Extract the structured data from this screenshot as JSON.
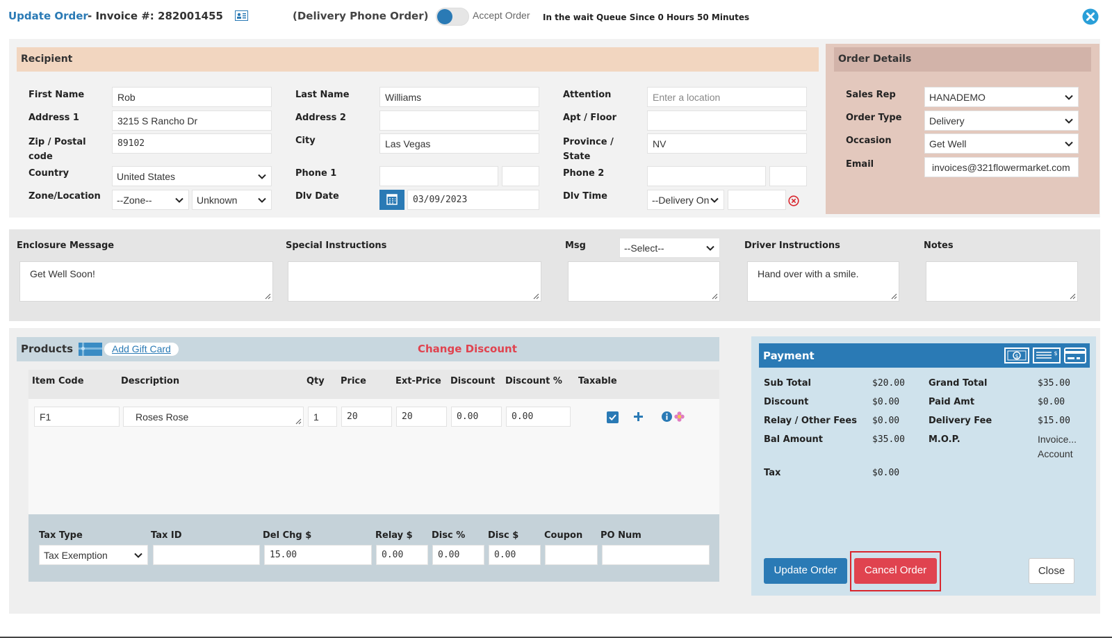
{
  "header": {
    "title": "Update Order",
    "invoice_label": "- Invoice #: 282001455",
    "order_kind": "(Delivery Phone Order)",
    "accept_label": "Accept Order",
    "queue_text": "In the wait Queue Since 0 Hours 50 Minutes"
  },
  "recipient": {
    "heading": "Recipient",
    "first_name_label": "First Name",
    "first_name": "Rob",
    "last_name_label": "Last Name",
    "last_name": "Williams",
    "attention_label": "Attention",
    "attention_placeholder": "Enter a location",
    "address1_label": "Address 1",
    "address1": "3215 S Rancho Dr",
    "address2_label": "Address 2",
    "address2": "",
    "apt_label": "Apt / Floor",
    "apt": "",
    "zip_label": "Zip / Postal code",
    "zip": "89102",
    "city_label": "City",
    "city": "Las Vegas",
    "province_label": "Province / State",
    "province": "NV",
    "country_label": "Country",
    "country": "United States",
    "phone1_label": "Phone 1",
    "phone2_label": "Phone 2",
    "zone_label": "Zone/Location",
    "zone": "--Zone--",
    "location": "Unknown",
    "dlv_date_label": "Dlv Date",
    "dlv_date": "03/09/2023",
    "dlv_time_label": "Dlv Time",
    "dlv_time": "--Delivery On"
  },
  "order_details": {
    "heading": "Order Details",
    "sales_rep_label": "Sales Rep",
    "sales_rep": "HANADEMO",
    "order_type_label": "Order Type",
    "order_type": "Delivery",
    "occasion_label": "Occasion",
    "occasion": "Get Well",
    "email_label": "Email",
    "email": "invoices@321flowermarket.com"
  },
  "messages": {
    "enclosure_label": "Enclosure Message",
    "enclosure": "Get Well Soon!",
    "special_label": "Special Instructions",
    "special": "",
    "msg_label": "Msg",
    "msg_select": "--Select--",
    "msg": "",
    "driver_label": "Driver Instructions",
    "driver": "Hand over with a smile.",
    "notes_label": "Notes",
    "notes": ""
  },
  "products": {
    "heading": "Products",
    "add_gift_card": "Add Gift Card",
    "change_discount": "Change Discount",
    "columns": [
      "Item Code",
      "Description",
      "Qty",
      "Price",
      "Ext-Price",
      "Discount",
      "Discount %",
      "Taxable"
    ],
    "row": {
      "item_code": "F1",
      "description": "Roses Rose",
      "qty": "1",
      "price": "20",
      "ext_price": "20",
      "discount": "0.00",
      "discount_pct": "0.00"
    },
    "footer_labels": [
      "Tax Type",
      "Tax ID",
      "Del Chg $",
      "Relay $",
      "Disc %",
      "Disc $",
      "Coupon",
      "PO Num"
    ],
    "tax_type": "Tax Exemption",
    "del_chg": "15.00",
    "relay": "0.00",
    "disc_pct": "0.00",
    "disc_amt": "0.00"
  },
  "payment": {
    "heading": "Payment",
    "sub_total_label": "Sub Total",
    "sub_total": "$20.00",
    "discount_label": "Discount",
    "discount": "$0.00",
    "relay_label": "Relay / Other Fees",
    "relay": "$0.00",
    "bal_label": "Bal Amount",
    "bal": "$35.00",
    "tax_label": "Tax",
    "tax": "$0.00",
    "grand_label": "Grand Total",
    "grand": "$35.00",
    "paid_label": "Paid Amt",
    "paid": "$0.00",
    "delivery_label": "Delivery Fee",
    "delivery": "$15.00",
    "mop_label": "M.O.P.",
    "mop_line1": "Invoice...",
    "mop_line2": "Account"
  },
  "buttons": {
    "update": "Update Order",
    "cancel": "Cancel Order",
    "close": "Close"
  },
  "colors": {
    "accent_blue": "#2a7ab5",
    "danger_red": "#e0434f",
    "recipient_bar": "#f2d6c0",
    "order_panel": "#e3c8bd",
    "payment_panel": "#cfe2ec"
  }
}
